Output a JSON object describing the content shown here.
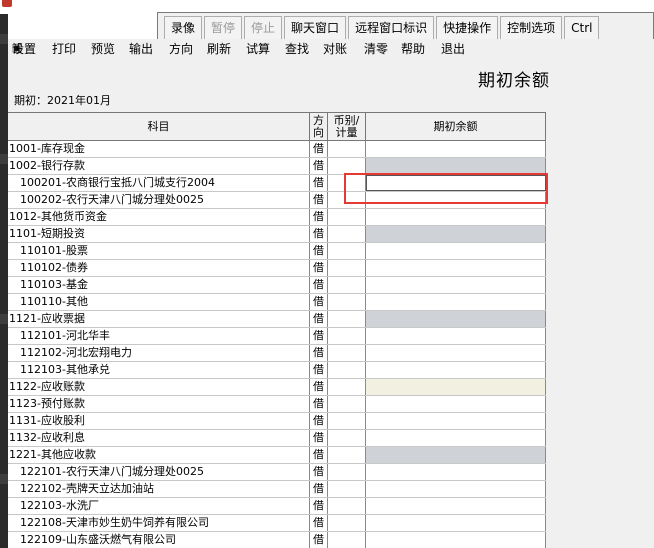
{
  "remote_toolbar": {
    "buttons": [
      {
        "label": "录像",
        "disabled": false
      },
      {
        "label": "暂停",
        "disabled": true
      },
      {
        "label": "停止",
        "disabled": true
      },
      {
        "label": "聊天窗口",
        "disabled": false
      },
      {
        "label": "远程窗口标识",
        "disabled": false
      },
      {
        "label": "快捷操作",
        "disabled": false
      },
      {
        "label": "控制选项",
        "disabled": false
      },
      {
        "label": "Ctrl",
        "disabled": false
      }
    ]
  },
  "menubar": {
    "items": [
      "设置",
      "打印",
      "预览",
      "输出",
      "方向",
      "刷新",
      "试算",
      "查找",
      "对账",
      "清零",
      "帮助",
      "退出"
    ]
  },
  "page": {
    "heading": "期初余额",
    "period": "期初：2021年01月"
  },
  "grid": {
    "headers": {
      "subject": "科目",
      "direction_line1": "方",
      "direction_line2": "向",
      "currency_line1": "币别/",
      "currency_line2": "计量",
      "balance": "期初余额"
    },
    "rows": [
      {
        "subject": "1001-库存现金",
        "dir": "借",
        "level": 1,
        "fill": "none"
      },
      {
        "subject": "1002-银行存款",
        "dir": "借",
        "level": 1,
        "fill": "grey"
      },
      {
        "subject": "100201-农商银行宝抵八门城支行2004",
        "dir": "借",
        "level": 2,
        "fill": "editing"
      },
      {
        "subject": "100202-农行天津八门城分理处0025",
        "dir": "借",
        "level": 2,
        "fill": "none"
      },
      {
        "subject": "1012-其他货币资金",
        "dir": "借",
        "level": 1,
        "fill": "none"
      },
      {
        "subject": "1101-短期投资",
        "dir": "借",
        "level": 1,
        "fill": "grey"
      },
      {
        "subject": "110101-股票",
        "dir": "借",
        "level": 2,
        "fill": "none"
      },
      {
        "subject": "110102-债券",
        "dir": "借",
        "level": 2,
        "fill": "none"
      },
      {
        "subject": "110103-基金",
        "dir": "借",
        "level": 2,
        "fill": "none"
      },
      {
        "subject": "110110-其他",
        "dir": "借",
        "level": 2,
        "fill": "none"
      },
      {
        "subject": "1121-应收票据",
        "dir": "借",
        "level": 1,
        "fill": "grey"
      },
      {
        "subject": "112101-河北华丰",
        "dir": "借",
        "level": 2,
        "fill": "none"
      },
      {
        "subject": "112102-河北宏翔电力",
        "dir": "借",
        "level": 2,
        "fill": "none"
      },
      {
        "subject": "112103-其他承兑",
        "dir": "借",
        "level": 2,
        "fill": "none"
      },
      {
        "subject": "1122-应收账款",
        "dir": "借",
        "level": 1,
        "fill": "cream"
      },
      {
        "subject": "1123-预付账款",
        "dir": "借",
        "level": 1,
        "fill": "none"
      },
      {
        "subject": "1131-应收股利",
        "dir": "借",
        "level": 1,
        "fill": "none"
      },
      {
        "subject": "1132-应收利息",
        "dir": "借",
        "level": 1,
        "fill": "none"
      },
      {
        "subject": "1221-其他应收款",
        "dir": "借",
        "level": 1,
        "fill": "grey"
      },
      {
        "subject": "122101-农行天津八门城分理处0025",
        "dir": "借",
        "level": 2,
        "fill": "none"
      },
      {
        "subject": "122102-壳牌天立达加油站",
        "dir": "借",
        "level": 2,
        "fill": "none"
      },
      {
        "subject": "122103-水洗厂",
        "dir": "借",
        "level": 2,
        "fill": "none"
      },
      {
        "subject": "122108-天津市妙生奶牛饲养有限公司",
        "dir": "借",
        "level": 2,
        "fill": "none"
      },
      {
        "subject": "122109-山东盛沃燃气有限公司",
        "dir": "借",
        "level": 2,
        "fill": "none"
      }
    ]
  },
  "colors": {
    "highlight": "#e53935",
    "parent_row_fill": "#cfd2d6",
    "selected_row_fill": "#f1f0e1"
  }
}
